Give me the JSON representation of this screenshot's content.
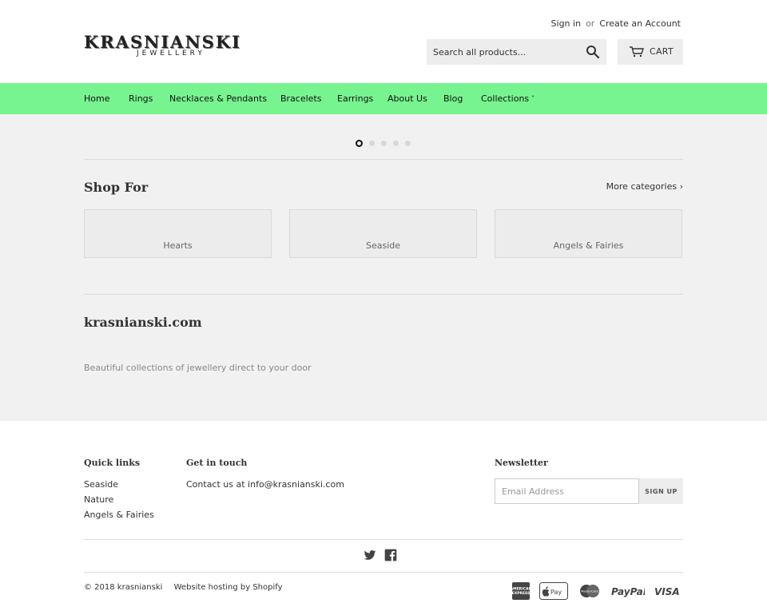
{
  "brand": {
    "name": "KRASNIANSKI",
    "tagline": "JEWELLERY"
  },
  "account": {
    "sign_in": "Sign in",
    "or": "or",
    "create": "Create an Account"
  },
  "search": {
    "placeholder": "Search all products..."
  },
  "cart": {
    "label": "CART"
  },
  "colors": {
    "nav_bg": "#77f48f",
    "content_bg": "#f1f1f1"
  },
  "nav": {
    "items": [
      {
        "label": "Home"
      },
      {
        "label": "Rings"
      },
      {
        "label": "Necklaces & Pendants"
      },
      {
        "label": "Bracelets"
      },
      {
        "label": "Earrings"
      },
      {
        "label": "About Us"
      },
      {
        "label": "Blog"
      },
      {
        "label": "Collections",
        "chevron": "˅"
      }
    ]
  },
  "slideshow": {
    "count": 5,
    "active": 1
  },
  "shop_for": {
    "title": "Shop For",
    "more": "More categories ›",
    "cards": [
      {
        "label": "Hearts"
      },
      {
        "label": "Seaside"
      },
      {
        "label": "Angels & Fairies"
      }
    ]
  },
  "about": {
    "title": "krasnianski.com",
    "description": "Beautiful collections of jewellery direct to your door"
  },
  "footer": {
    "quick_links": {
      "title": "Quick links",
      "items": [
        {
          "label": "Seaside"
        },
        {
          "label": "Nature"
        },
        {
          "label": "Angels & Fairies"
        }
      ]
    },
    "contact": {
      "title": "Get in touch",
      "text": "Contact us at info@krasnianski.com"
    },
    "newsletter": {
      "title": "Newsletter",
      "placeholder": "Email Address",
      "button": "SIGN UP"
    },
    "social": [
      "twitter-icon",
      "facebook-icon"
    ],
    "copyright": "© 2018 krasnianski",
    "hosting": "Website hosting by Shopify",
    "payments": [
      "American Express",
      "Apple Pay",
      "MasterCard",
      "PayPal",
      "VISA"
    ]
  }
}
